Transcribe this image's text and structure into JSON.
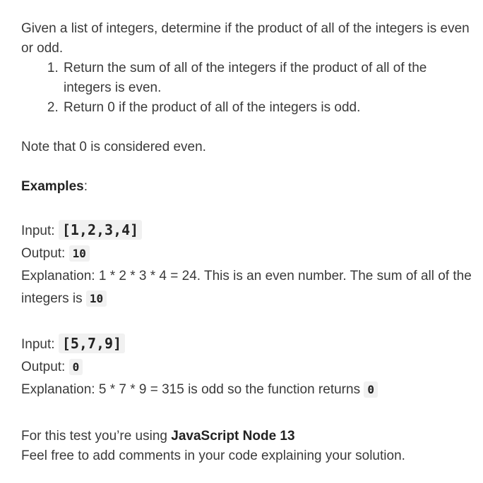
{
  "intro": "Given a list of integers, determine if the product of all of the integers is even or odd.",
  "rules": [
    "Return the sum of all of the integers if the product of all of the integers is even.",
    "Return 0 if the product of all of the integers is odd."
  ],
  "note": "Note that 0 is considered even.",
  "examples_heading": "Examples",
  "examples_colon": ":",
  "examples": [
    {
      "input_label": "Input:",
      "input_value": "[1,2,3,4]",
      "output_label": "Output:",
      "output_value": "10",
      "explanation_text": "Explanation: 1 * 2 * 3 * 4 = 24. This is an even number. The sum of all of the integers is",
      "explanation_value": "10"
    },
    {
      "input_label": "Input:",
      "input_value": "[5,7,9]",
      "output_label": "Output:",
      "output_value": "0",
      "explanation_text": "Explanation: 5 * 7 * 9 = 315 is odd so the function returns",
      "explanation_value": "0"
    }
  ],
  "footer": {
    "prefix": "For this test you’re using",
    "language": "JavaScript Node 13",
    "line2": "Feel free to add comments in your code explaining your solution."
  }
}
